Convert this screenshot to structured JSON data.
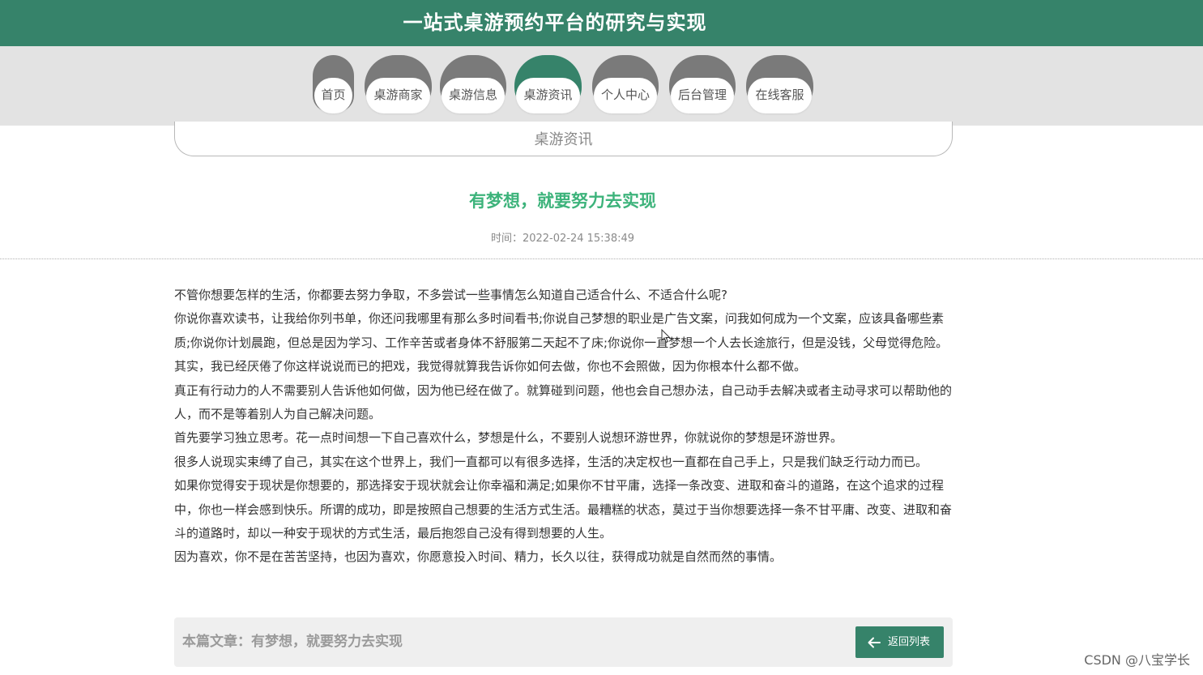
{
  "header": {
    "title": "一站式桌游预约平台的研究与实现"
  },
  "nav": {
    "items": [
      {
        "label": "首页",
        "active": false
      },
      {
        "label": "桌游商家",
        "active": false
      },
      {
        "label": "桌游信息",
        "active": false
      },
      {
        "label": "桌游资讯",
        "active": true
      },
      {
        "label": "个人中心",
        "active": false
      },
      {
        "label": "后台管理",
        "active": false
      },
      {
        "label": "在线客服",
        "active": false
      }
    ]
  },
  "breadcrumb": {
    "text": "桌游资讯"
  },
  "article": {
    "title": "有梦想，就要努力去实现",
    "time": "时间：2022-02-24 15:38:49",
    "paragraphs": [
      "不管你想要怎样的生活，你都要去努力争取，不多尝试一些事情怎么知道自己适合什么、不适合什么呢?",
      "你说你喜欢读书，让我给你列书单，你还问我哪里有那么多时间看书;你说自己梦想的职业是广告文案，问我如何成为一个文案，应该具备哪些素质;你说你计划晨跑，但总是因为学习、工作辛苦或者身体不舒服第二天起不了床;你说你一直梦想一个人去长途旅行，但是没钱，父母觉得危险。其实，我已经厌倦了你这样说说而已的把戏，我觉得就算我告诉你如何去做，你也不会照做，因为你根本什么都不做。",
      "真正有行动力的人不需要别人告诉他如何做，因为他已经在做了。就算碰到问题，他也会自己想办法，自己动手去解决或者主动寻求可以帮助他的人，而不是等着别人为自己解决问题。",
      "首先要学习独立思考。花一点时间想一下自己喜欢什么，梦想是什么，不要别人说想环游世界，你就说你的梦想是环游世界。",
      "很多人说现实束缚了自己，其实在这个世界上，我们一直都可以有很多选择，生活的决定权也一直都在自己手上，只是我们缺乏行动力而已。",
      "如果你觉得安于现状是你想要的，那选择安于现状就会让你幸福和满足;如果你不甘平庸，选择一条改变、进取和奋斗的道路，在这个追求的过程中，你也一样会感到快乐。所谓的成功，即是按照自己想要的生活方式生活。最糟糕的状态，莫过于当你想要选择一条不甘平庸、改变、进取和奋斗的道路时，却以一种安于现状的方式生活，最后抱怨自己没有得到想要的人生。",
      "因为喜欢，你不是在苦苦坚持，也因为喜欢，你愿意投入时间、精力，长久以往，获得成功就是自然而然的事情。"
    ]
  },
  "footer": {
    "label": "本篇文章：有梦想，就要努力去实现",
    "back_label": "返回列表",
    "back_icon": "arrow-left-icon"
  },
  "watermark": {
    "text": "CSDN @八宝学长"
  },
  "colors": {
    "primary": "#36836a",
    "title_green": "#3db37b",
    "nav_bg": "#e3e3e3"
  }
}
